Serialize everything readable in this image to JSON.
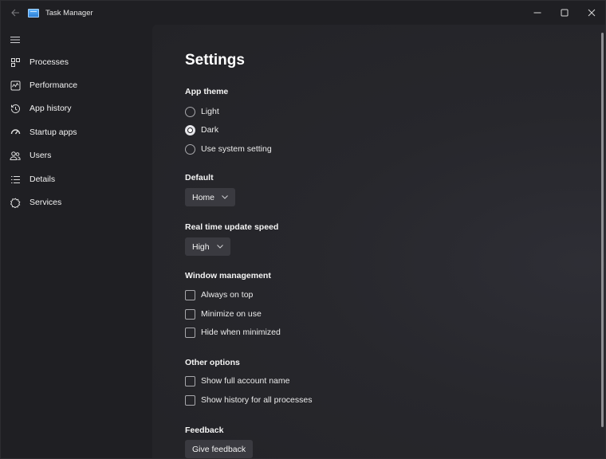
{
  "window": {
    "title": "Task Manager"
  },
  "sidebar": {
    "items": [
      {
        "label": "Processes",
        "icon": "processes-icon"
      },
      {
        "label": "Performance",
        "icon": "performance-icon"
      },
      {
        "label": "App history",
        "icon": "history-icon"
      },
      {
        "label": "Startup apps",
        "icon": "startup-icon"
      },
      {
        "label": "Users",
        "icon": "users-icon"
      },
      {
        "label": "Details",
        "icon": "details-icon"
      },
      {
        "label": "Services",
        "icon": "services-icon"
      }
    ]
  },
  "settings": {
    "title": "Settings",
    "app_theme": {
      "label": "App theme",
      "options": [
        "Light",
        "Dark",
        "Use system setting"
      ],
      "selected": "Dark"
    },
    "default_page": {
      "label": "Default",
      "value": "Home"
    },
    "update_speed": {
      "label": "Real time update speed",
      "value": "High"
    },
    "window_management": {
      "label": "Window management",
      "options": [
        {
          "label": "Always on top",
          "checked": false
        },
        {
          "label": "Minimize on use",
          "checked": false
        },
        {
          "label": "Hide when minimized",
          "checked": false
        }
      ]
    },
    "other_options": {
      "label": "Other options",
      "options": [
        {
          "label": "Show full account name",
          "checked": false
        },
        {
          "label": "Show history for all processes",
          "checked": false
        }
      ]
    },
    "feedback": {
      "label": "Feedback",
      "button": "Give feedback"
    }
  },
  "colors": {
    "background": "#1f1f23",
    "content": "#27272c",
    "control": "#3a3a40",
    "text": "#ffffff"
  }
}
